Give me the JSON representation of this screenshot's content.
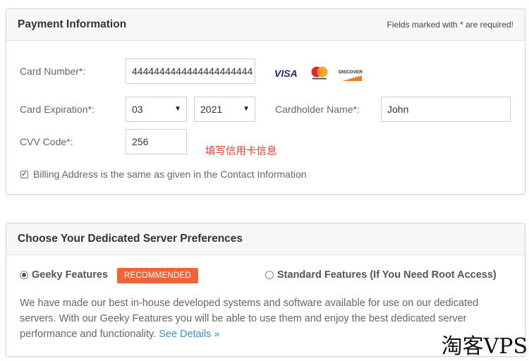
{
  "payment": {
    "title": "Payment Information",
    "required_note": "Fields marked with * are required!",
    "card_number_label": "Card Number*:",
    "card_number_value": "4444444444444444444444",
    "card_logos": [
      "VISA",
      "MasterCard",
      "DISCOVER"
    ],
    "expiration_label": "Card Expiration*:",
    "exp_month": "03",
    "exp_year": "2021",
    "cardholder_label": "Cardholder Name*:",
    "cardholder_value": "John",
    "cvv_label": "CVV Code*:",
    "cvv_value": "256",
    "annotation": "填写信用卡信息",
    "billing_same_label": "Billing Address is the same as given in the Contact Information",
    "billing_same_checked": true
  },
  "preferences": {
    "title": "Choose Your Dedicated Server Preferences",
    "option_geeky": "Geeky Features",
    "recommended_badge": "RECOMMENDED",
    "option_standard": "Standard Features (If You Need Root Access)",
    "selected": "Geeky Features",
    "description_line1": "We have made our best in-house developed systems and software available for use on our dedicated",
    "description_line2": "servers. With our Geeky Features you will be able to use them and enjoy the best dedicated server",
    "description_line3": "performance and functionality.",
    "see_details": "See Details »"
  },
  "watermark": "淘客VPS",
  "colors": {
    "badge": "#f0643a",
    "link": "#3b8fce",
    "annotation": "#e03b2b"
  }
}
